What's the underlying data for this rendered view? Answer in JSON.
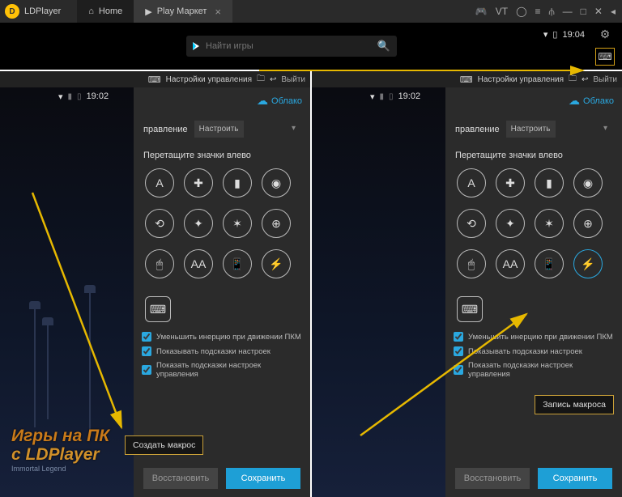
{
  "topbar": {
    "brand": "LDPlayer",
    "home_tab": "Home",
    "active_tab": "Play Маркет"
  },
  "search": {
    "placeholder": "Найти игры",
    "time": "19:04"
  },
  "panel": {
    "title": "Настройки управления",
    "exit": "Выйти",
    "phone_time": "19:02",
    "cloud": "Облако",
    "control_label": "правление",
    "control_value": "Настроить",
    "drag_hint": "Перетащите значки влево",
    "icons": {
      "r1": [
        "A",
        "✚",
        "▮",
        "◉"
      ],
      "r2": [
        "⟲",
        "✦",
        "✶",
        "⊕"
      ],
      "r3": [
        "🖱",
        "AA",
        "📱",
        "⚡"
      ]
    },
    "macro_icon": "⌨",
    "checks": [
      "Уменьшить инерцию при движении ПКМ",
      "Показывать подсказки настроек",
      "Показать подсказки настроек управления"
    ],
    "restore": "Восстановить",
    "save": "Сохранить"
  },
  "tips": {
    "left": "Создать макрос",
    "right": "Запись макроса"
  },
  "watermark": {
    "l1": "Игры на ПК",
    "l2": "c LDPlayer",
    "sub": "Immortal Legend"
  }
}
